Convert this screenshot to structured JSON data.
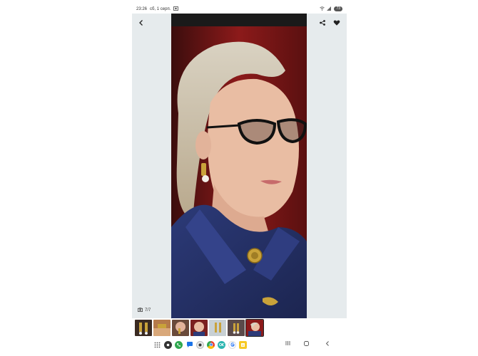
{
  "status_bar": {
    "time": "23:26",
    "date": "сб, 1 серп.",
    "battery": "73"
  },
  "viewer": {
    "counter": "7/7",
    "icons": [
      "back-arrow-icon",
      "share-icon",
      "heart-icon",
      "camera-icon"
    ],
    "thumbnail_count": 7,
    "selected_thumbnail": 6
  },
  "nav_bar": {
    "apps": [
      "app-grid",
      "camera",
      "phone",
      "messages",
      "record",
      "chrome",
      "ok",
      "google",
      "notes"
    ]
  }
}
